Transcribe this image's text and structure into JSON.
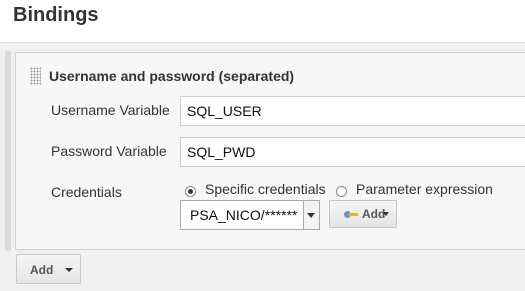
{
  "page": {
    "title": "Bindings"
  },
  "binding": {
    "title": "Username and password (separated)",
    "username_label": "Username Variable",
    "username_value": "SQL_USER",
    "password_label": "Password Variable",
    "password_value": "SQL_PWD",
    "credentials_label": "Credentials",
    "radio_specific": "Specific credentials",
    "radio_parameter": "Parameter expression",
    "selected_option": "specific",
    "credentials_select_value": "PSA_NICO/******",
    "add_credentials_label": "Add"
  },
  "footer": {
    "add_label": "Add"
  },
  "icons": {
    "drag": "drag-handle-icon",
    "key": "key-icon"
  }
}
